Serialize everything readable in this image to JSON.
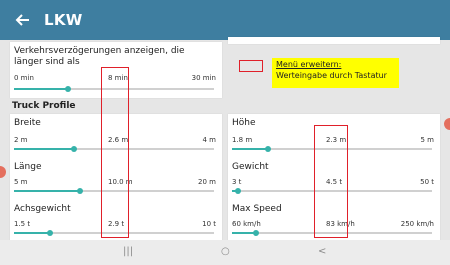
{
  "app": {
    "title": "LKW"
  },
  "top_left_card": {
    "heading": "Verkehrsverzögerungen anzeigen, die länger sind als",
    "slider": {
      "min": "0 min",
      "value": "8 min",
      "max": "30 min"
    }
  },
  "callout": {
    "title": "Menü erweitern:",
    "subtitle": "Werteingabe durch Tastatur"
  },
  "section": {
    "truck_profile": "Truck Profile"
  },
  "left_items": [
    {
      "label": "Breite",
      "min": "2 m",
      "value": "2.6 m",
      "max": "4 m"
    },
    {
      "label": "Länge",
      "min": "5 m",
      "value": "10.0 m",
      "max": "20 m"
    },
    {
      "label": "Achsgewicht",
      "min": "1.5 t",
      "value": "2.9 t",
      "max": "10 t"
    }
  ],
  "right_items": [
    {
      "label": "Höhe",
      "min": "1.8 m",
      "value": "2.3 m",
      "max": "5 m"
    },
    {
      "label": "Gewicht",
      "min": "3 t",
      "value": "4.5 t",
      "max": "50 t"
    },
    {
      "label": "Max Speed",
      "min": "60 km/h",
      "value": "83 km/h",
      "max": "250 km/h"
    }
  ],
  "nav": {
    "recent": "|||",
    "home": "○",
    "back": "<"
  }
}
